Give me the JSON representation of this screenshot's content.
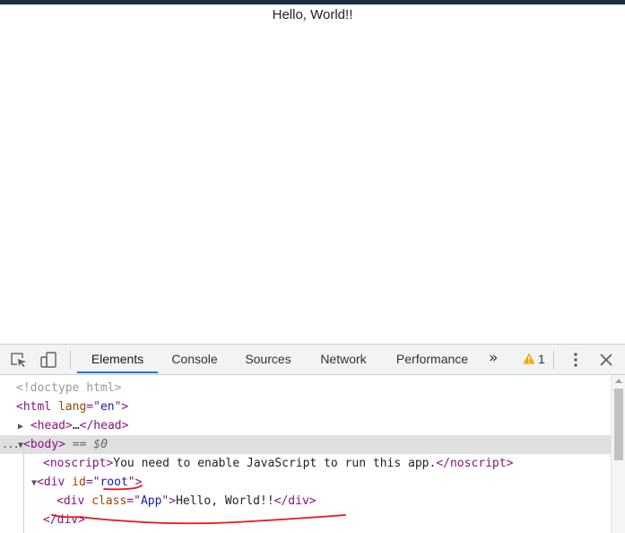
{
  "page": {
    "content_text": "Hello, World!!"
  },
  "devtools": {
    "tabs": [
      {
        "label": "Elements",
        "active": true
      },
      {
        "label": "Console",
        "active": false
      },
      {
        "label": "Sources",
        "active": false
      },
      {
        "label": "Network",
        "active": false
      },
      {
        "label": "Performance",
        "active": false
      }
    ],
    "more_tabs_glyph": "»",
    "warning_count": "1",
    "accent_color": "#1a73e8",
    "warning_color": "#f2a600",
    "icons": [
      "inspect-element-icon",
      "device-toolbar-icon",
      "warning-icon",
      "kebab-menu-icon",
      "close-icon"
    ]
  },
  "dom_tree": {
    "doctype": "<!doctype html>",
    "html_open_tag": "<html",
    "html_lang_attr": "lang",
    "html_lang_value": "en",
    "head_open": "<head>",
    "head_ellipsis": "…",
    "head_close": "</head>",
    "body_open": "<body>",
    "body_selected_marker": "== $0",
    "noscript_open": "<noscript>",
    "noscript_text": "You need to enable JavaScript to run this app.",
    "noscript_close": "</noscript>",
    "div_root_open": "<div",
    "div_root_attr": "id",
    "div_root_value": "root",
    "div_app_open": "<div",
    "div_app_attr": "class",
    "div_app_value": "App",
    "div_app_text": "Hello, World!!",
    "div_app_close": "</div>",
    "div_root_close": "</div>",
    "eq_quote": "=\"",
    "quote_close": "\">",
    "quote_close_plain": "\">",
    "ellipsis_marker": "..."
  },
  "annotation_color": "#e8141b"
}
